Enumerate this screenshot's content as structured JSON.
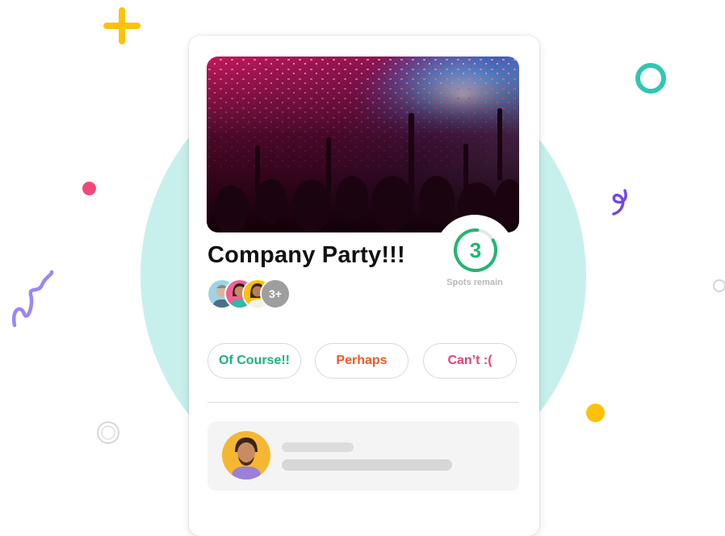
{
  "event": {
    "title": "Company Party!!!",
    "spots_remaining": "3",
    "spots_label": "Spots remain",
    "attendees_more": "3+"
  },
  "rsvp": {
    "yes_label": "Of Course!!",
    "maybe_label": "Perhaps",
    "no_label": "Can’t :("
  },
  "colors": {
    "accent_green": "#22b573",
    "maybe_orange": "#f05a22",
    "no_pink": "#e5407a",
    "background_circle": "#c7f0ec"
  },
  "icons": {
    "spots_counter": "progress-ring-icon",
    "comment_avatar": "user-avatar"
  }
}
